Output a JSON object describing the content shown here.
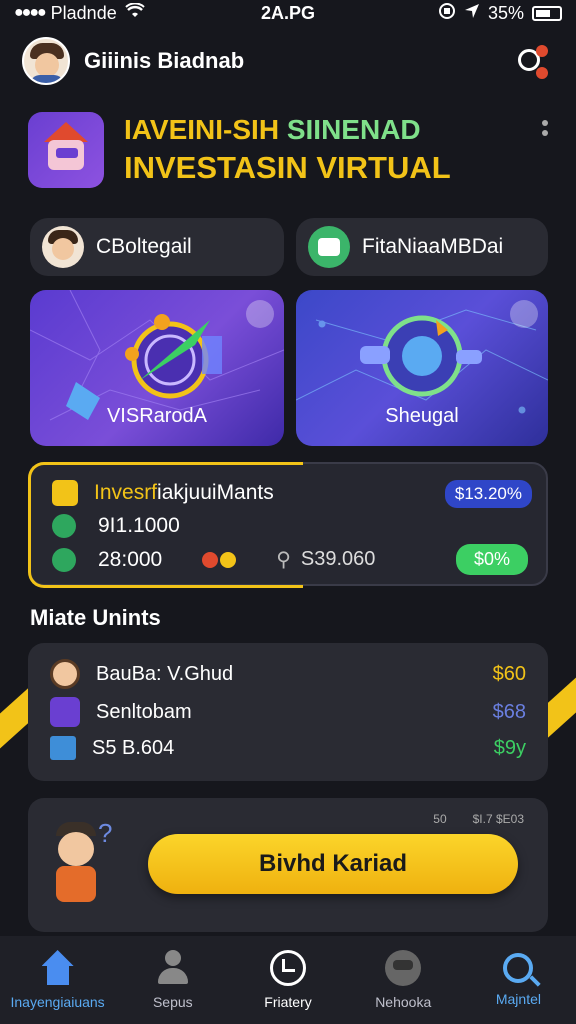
{
  "status_bar": {
    "carrier": "Pladnde",
    "time": "2A.PG",
    "battery": "35%"
  },
  "header": {
    "username": "Giiinis Biadnab",
    "avatar_icon": "user-avatar-icon",
    "settings_icon": "settings-notification-icon"
  },
  "brand": {
    "title_part1": "IAVEINI-SIH ",
    "title_part2": "SIINENAD",
    "title_line2": "INVESTASIN VIRTUAL",
    "logo_icon": "app-logo-icon",
    "colors": {
      "title": "#f2c318",
      "accent": "#7fe08a"
    }
  },
  "pills": [
    {
      "label": "CBoltegail",
      "icon": "user-avatar-icon"
    },
    {
      "label": "FitaNiaaMBDai",
      "icon": "chat-icon"
    }
  ],
  "cards": [
    {
      "label": "VISRarodA",
      "icon": "rocket-target-icon"
    },
    {
      "label": "Sheugal",
      "icon": "gear-target-icon"
    }
  ],
  "portfolio": {
    "title_yellow": "Invesrf",
    "title_white": "iakjuuiMants",
    "badge": "$13.20%",
    "value1": "9I1.1000",
    "value2": "28:000",
    "secondary_value": "S39.060",
    "percent": "$0%",
    "colors": {
      "highlight": "#f2c318",
      "positive": "#3ccf63",
      "badge": "#2f46c8"
    }
  },
  "section_title": "Miate Unints",
  "units": [
    {
      "name": "BauBa: V.Ghud",
      "amount": "$60",
      "color": "#f2c318",
      "icon": "user-avatar-icon"
    },
    {
      "name": "Senltobam",
      "amount": "$68",
      "color": "#6a7fe0",
      "icon": "edit-icon"
    },
    {
      "name": "S5 B.604",
      "amount": "$9y",
      "color": "#3ccf63",
      "icon": "chart-icon"
    }
  ],
  "cta": {
    "mini_left": "50",
    "mini_right": "$I.7 $E03",
    "button_label": "Bivhd Kariad",
    "mascot_icon": "mascot-icon"
  },
  "nav": [
    {
      "label": "Inayengiaiuans",
      "icon": "home-icon",
      "active": true
    },
    {
      "label": "Sepus",
      "icon": "user-icon",
      "active": false
    },
    {
      "label": "Friatery",
      "icon": "history-icon",
      "active": false
    },
    {
      "label": "Nehooka",
      "icon": "bot-icon",
      "active": false
    },
    {
      "label": "Majntel",
      "icon": "search-icon",
      "active": true
    }
  ]
}
